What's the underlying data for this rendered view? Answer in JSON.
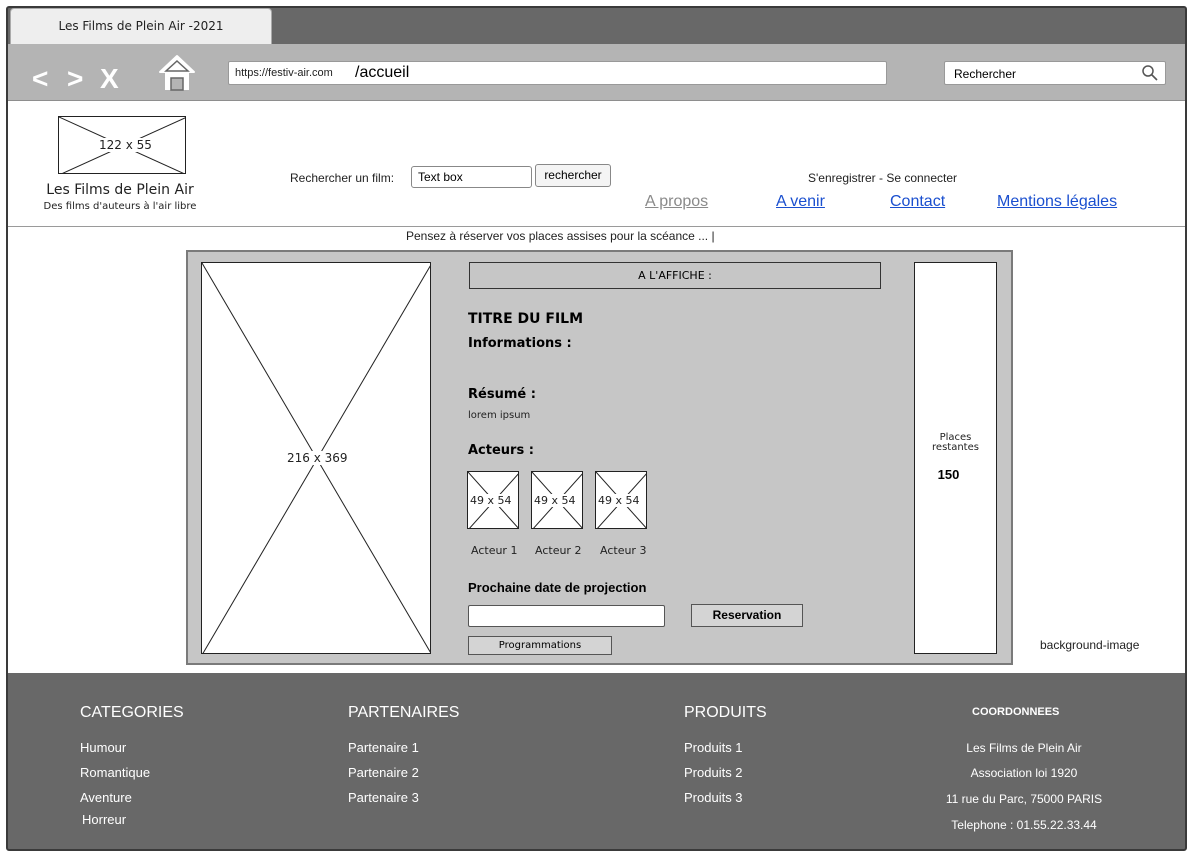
{
  "browser": {
    "tab_title": "Les Films de Plein Air -2021",
    "nav": {
      "back": "<",
      "forward": ">",
      "close": "X"
    },
    "url_host": "https://festiv-air.com",
    "url_path": "/accueil",
    "search_label": "Rechercher"
  },
  "header": {
    "logo_placeholder": "122 x 55",
    "site_name": "Les Films de Plein Air",
    "tagline": "Des films d'auteurs à l'air libre",
    "search_label": "Rechercher un film:",
    "search_input": "Text box",
    "search_button": "rechercher",
    "auth_links": "S'enregistrer  -  Se connecter",
    "nav_links": [
      "A propos",
      "A venir",
      "Contact",
      "Mentions légales"
    ]
  },
  "ticker": "Pensez à réserver vos places assises pour la scéance ... |",
  "main": {
    "poster_placeholder": "216 x 369",
    "affiche_label": "A L'AFFICHE :",
    "film_title": "TITRE DU FILM",
    "info_label": "Informations :",
    "summary_label": "Résumé :",
    "summary_text": "lorem ipsum",
    "actors_label": "Acteurs :",
    "actors": [
      {
        "placeholder": "49 x 54",
        "caption": "Acteur 1"
      },
      {
        "placeholder": "49 x 54",
        "caption": "Acteur 2"
      },
      {
        "placeholder": "49 x 54",
        "caption": "Acteur 3"
      }
    ],
    "next_date_label": "Prochaine date de projection",
    "reservation_button": "Reservation",
    "programmations_button": "Programmations",
    "seats_label_line1": "Places",
    "seats_label_line2": "restantes",
    "seats_count": "150",
    "background_label": "background-image"
  },
  "footer": {
    "categories": {
      "title": "CATEGORIES",
      "items": [
        "Humour",
        "Romantique",
        "Aventure",
        "Horreur"
      ]
    },
    "partners": {
      "title": "PARTENAIRES",
      "items": [
        "Partenaire 1",
        "Partenaire 2",
        "Partenaire 3"
      ]
    },
    "products": {
      "title": "PRODUITS",
      "items": [
        "Produits 1",
        "Produits 2",
        "Produits 3"
      ]
    },
    "coordinates": {
      "title": "COORDONNEES",
      "lines": [
        "Les Films de Plein Air",
        "Association loi 1920",
        "11 rue du Parc, 75000 PARIS",
        "Telephone : 01.55.22.33.44"
      ]
    }
  },
  "colors": {
    "link_blue": "#1a4fcf",
    "link_disabled": "#8a8a8a",
    "chrome_dark": "#686868",
    "chrome_light": "#b4b4b4",
    "panel_gray": "#c6c6c6"
  },
  "icons": [
    "home-icon",
    "search-icon"
  ]
}
